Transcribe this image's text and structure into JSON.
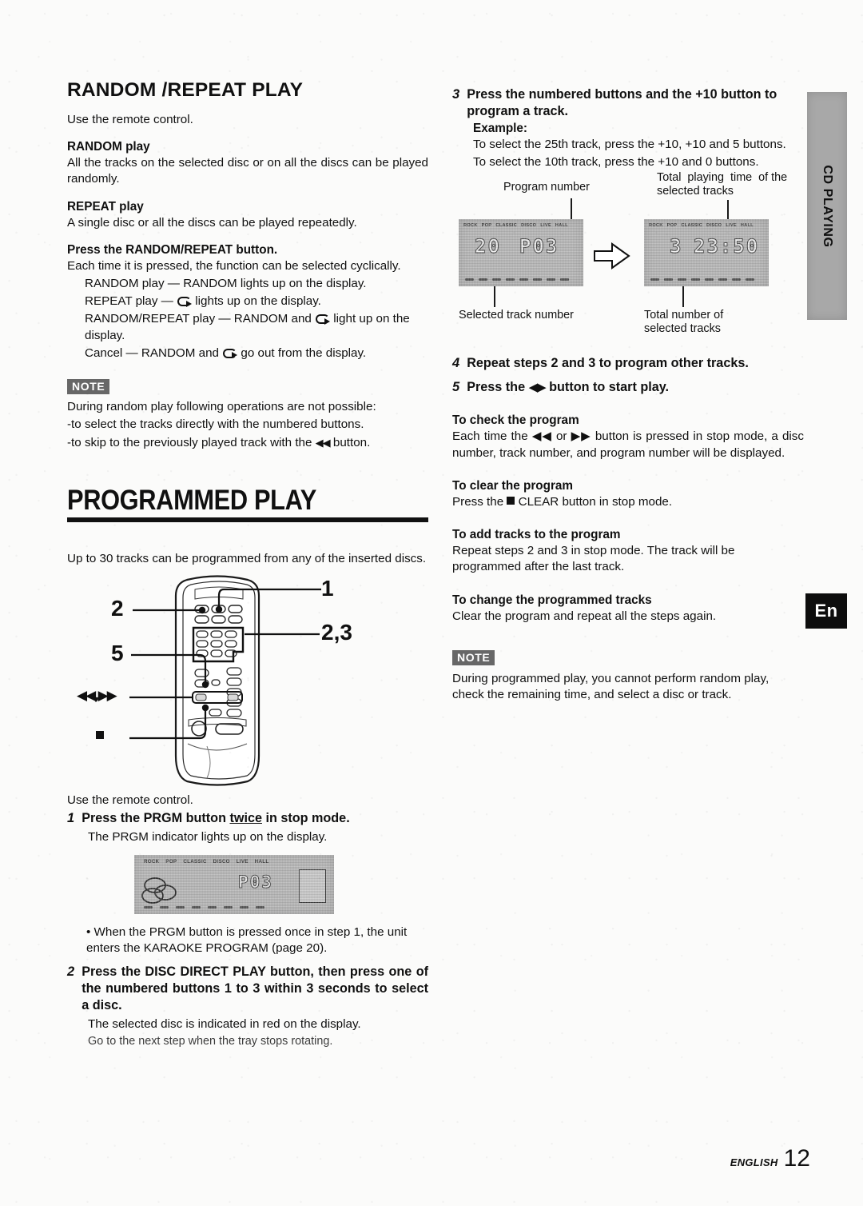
{
  "page": {
    "footer_label": "ENGLISH",
    "page_number": "12",
    "side_tab": "CD PLAYING",
    "lang_badge": "En"
  },
  "left": {
    "section_title": "RANDOM /REPEAT PLAY",
    "intro": "Use the remote control.",
    "random_head": "RANDOM play",
    "random_body": "All the tracks on the selected disc or on all the discs can be played randomly.",
    "repeat_head": "REPEAT play",
    "repeat_body": "A single disc or all the discs can be played repeatedly.",
    "press_head": "Press the RANDOM/REPEAT button.",
    "press_body": "Each time it is pressed, the function can be selected cyclically.",
    "cycle": [
      "RANDOM play — RANDOM lights up on the display.",
      "REPEAT play — [repeat] lights up on the display.",
      "RANDOM/REPEAT play — RANDOM and [repeat] light up on the display.",
      "Cancel — RANDOM and [repeat] go out from the display."
    ],
    "note_badge": "NOTE",
    "note_lines": [
      "During random play following operations are not possible:",
      "-to select the tracks directly with the numbered buttons.",
      "-to skip to the previously played track with the ◀◀ button."
    ],
    "prog_title": "PROGRAMMED PLAY",
    "prog_intro": "Up to 30 tracks can be programmed from any of the inserted discs.",
    "remote_callouts": {
      "c1": "1",
      "c2": "2",
      "c23": "2,3",
      "c5": "5",
      "cskip": "◀◀,▶▶",
      "cstop": "■"
    },
    "use_remote": "Use the remote control.",
    "step1_num": "1",
    "step1_pre": "Press the PRGM button ",
    "step1_underline": "twice",
    "step1_post": " in stop mode.",
    "step1_sub": "The PRGM indicator lights up on the display.",
    "bullet1": "• When the PRGM button is pressed once in step 1, the unit enters the KARAOKE PROGRAM (page 20).",
    "step2_num": "2",
    "step2_body": "Press the DISC DIRECT PLAY button, then press one of the numbered buttons 1 to 3 within 3 seconds to select a disc.",
    "step2_sub1": "The selected disc is indicated in red on the display.",
    "step2_sub2": "Go to the next step when the tray stops rotating.",
    "lcd_step1": {
      "eq_labels": [
        "ROCK",
        "POP",
        "CLASSIC",
        "DISCO",
        "LIVE",
        "HALL"
      ],
      "main_digits": "P03"
    }
  },
  "right": {
    "step3_num": "3",
    "step3_body": "Press the numbered buttons and the +10 button to program a track.",
    "example_head": "Example:",
    "example_line1": "To select the 25th track, press the +10, +10 and 5 buttons.",
    "example_line2": "To select the 10th track, press the +10 and 0 buttons.",
    "diagram": {
      "caption_program_number": "Program number",
      "caption_total_time": "Total playing time of the selected tracks",
      "caption_selected_track": "Selected track number",
      "caption_total_tracks": "Total number of selected tracks",
      "eq_labels": [
        "ROCK",
        "POP",
        "CLASSIC",
        "DISCO",
        "LIVE",
        "HALL"
      ],
      "left_display": {
        "track": "20",
        "program": "P03"
      },
      "right_display": {
        "count": "3",
        "time": "23:50"
      }
    },
    "step4_num": "4",
    "step4_body": "Repeat steps 2 and 3 to program other tracks.",
    "step5_num": "5",
    "step5_pre": "Press the ",
    "step5_sym": "◀▶",
    "step5_post": " button to start play.",
    "check_head": "To check the program",
    "check_body": "Each time the ◀◀ or ▶▶ button is pressed in stop mode, a disc number, track number, and program number will be displayed.",
    "clear_head": "To clear the program",
    "clear_body_pre": "Press the ",
    "clear_body_post": " CLEAR button in stop mode.",
    "add_head": "To add tracks to the program",
    "add_body": "Repeat steps 2 and 3 in stop mode. The track will be programmed after the last track.",
    "change_head": "To change the programmed tracks",
    "change_body": "Clear the program and repeat all the steps again.",
    "note_badge": "NOTE",
    "note_body": "During programmed play, you cannot perform random play, check the remaining time, and select a disc or track."
  }
}
